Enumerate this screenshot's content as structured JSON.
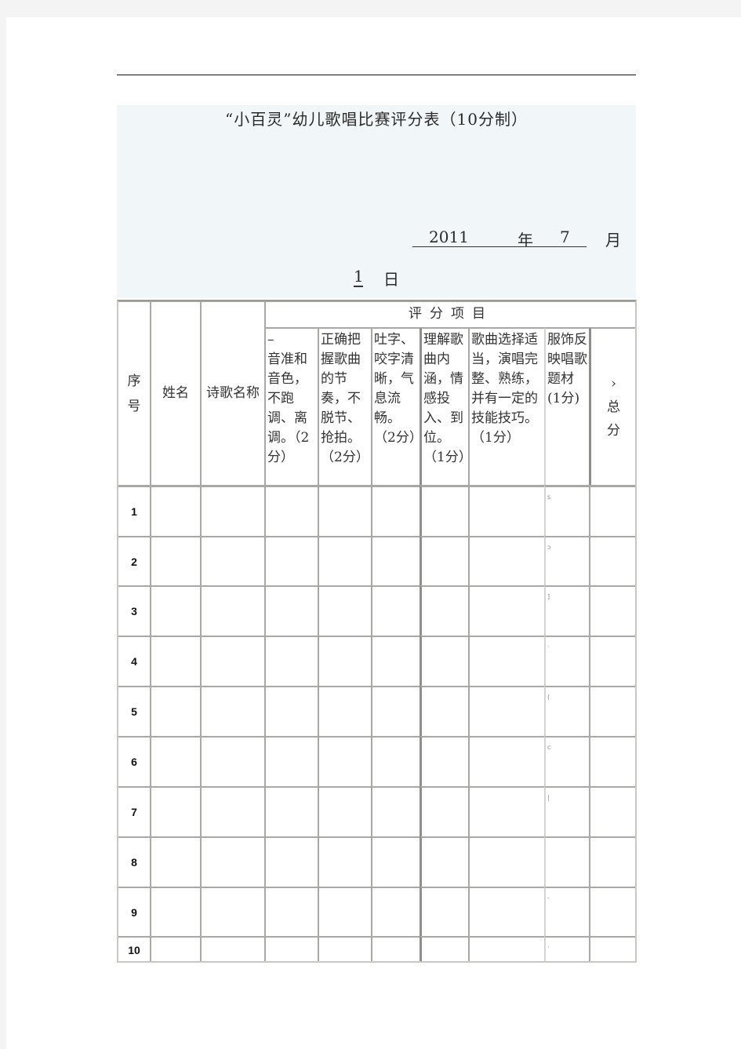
{
  "document": {
    "title": "“小百灵”幼儿歌唱比赛评分表（10分制）",
    "date": {
      "year": "2011",
      "year_unit": "年",
      "month": "7",
      "month_unit": "月",
      "day": "1",
      "day_unit": "日"
    }
  },
  "table": {
    "group_header": "评分项目",
    "columns": [
      {
        "key": "index",
        "label": "序\n号"
      },
      {
        "key": "name",
        "label": "姓名"
      },
      {
        "key": "song",
        "label": "诗歌名称"
      },
      {
        "key": "pitch",
        "label": "–\n音准和音色，不跑调、离调。（2分）"
      },
      {
        "key": "rhythm",
        "label": "正确把握歌曲的节奏，不脱节、抢拍。\n（2分）"
      },
      {
        "key": "diction",
        "label": "吐字、咬字清晰，气息流畅。\n（2分）"
      },
      {
        "key": "emotion",
        "label": "理解歌曲内涵，情感投入、到位。\n（1分）"
      },
      {
        "key": "selection",
        "label": "歌曲选择适当，演唱完整、熟练，并有一定的技能技巧。\n（1分）"
      },
      {
        "key": "costume",
        "label": "服饰反映唱歌题材\n(1分)"
      },
      {
        "key": "total",
        "label": "›\n总\n分"
      }
    ],
    "rows": [
      {
        "index": "1",
        "stray_mark": "s"
      },
      {
        "index": "2",
        "stray_mark": "ɔ"
      },
      {
        "index": "3",
        "stray_mark": "]"
      },
      {
        "index": "4",
        "stray_mark": "·"
      },
      {
        "index": "5",
        "stray_mark": "("
      },
      {
        "index": "6",
        "stray_mark": "c"
      },
      {
        "index": "7",
        "stray_mark": "|"
      },
      {
        "index": "8",
        "stray_mark": ""
      },
      {
        "index": "9",
        "stray_mark": "-"
      },
      {
        "index": "10",
        "stray_mark": "·"
      }
    ]
  }
}
